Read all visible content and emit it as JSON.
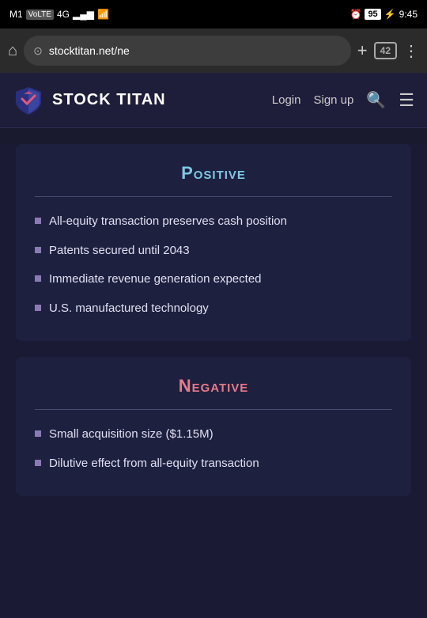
{
  "statusBar": {
    "carrier": "M1",
    "network1": "VoLTE",
    "network2": "4G",
    "signalBars": "▂▄▆",
    "wifiIcon": "wifi",
    "alarmIcon": "⏰",
    "battery": "95",
    "chargingIcon": "⚡",
    "time": "9:45"
  },
  "browserChrome": {
    "homeIcon": "⌂",
    "urlText": "stocktitan.net/ne",
    "addTabIcon": "+",
    "tabsCount": "42",
    "menuIcon": "⋮"
  },
  "appHeader": {
    "logoText": "STOCK TITAN",
    "loginLabel": "Login",
    "signupLabel": "Sign up",
    "searchIcon": "🔍",
    "menuIcon": "☰"
  },
  "sections": {
    "positive": {
      "title": "Positive",
      "divider": true,
      "bullets": [
        "All-equity transaction preserves cash position",
        "Patents secured until 2043",
        "Immediate revenue generation expected",
        "U.S. manufactured technology"
      ]
    },
    "negative": {
      "title": "Negative",
      "divider": true,
      "bullets": [
        "Small acquisition size ($1.15M)",
        "Dilutive effect from all-equity transaction"
      ]
    }
  }
}
